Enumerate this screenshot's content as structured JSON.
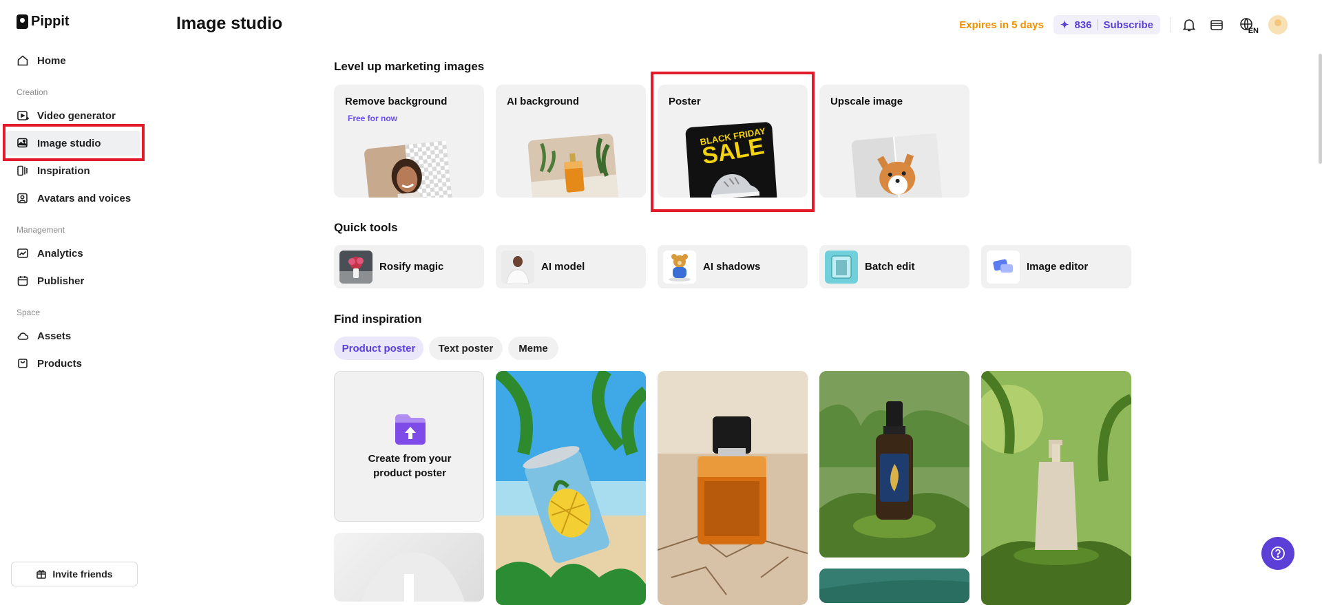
{
  "app": {
    "name": "Pippit"
  },
  "sidebar": {
    "home": "Home",
    "sections": {
      "creation": "Creation",
      "management": "Management",
      "space": "Space"
    },
    "items": [
      {
        "label": "Video generator"
      },
      {
        "label": "Image studio"
      },
      {
        "label": "Inspiration"
      },
      {
        "label": "Avatars and voices"
      },
      {
        "label": "Analytics"
      },
      {
        "label": "Publisher"
      },
      {
        "label": "Assets"
      },
      {
        "label": "Products"
      }
    ],
    "invite": "Invite friends"
  },
  "header": {
    "title": "Image studio",
    "expires": "Expires in 5 days",
    "credits": "836",
    "subscribe": "Subscribe",
    "language": "EN"
  },
  "marketing": {
    "title": "Level up marketing images",
    "cards": [
      {
        "label": "Remove background",
        "badge": "Free for now"
      },
      {
        "label": "AI background"
      },
      {
        "label": "Poster",
        "poster_text_1": "BLACK FRIDAY",
        "poster_text_2": "SALE"
      },
      {
        "label": "Upscale image"
      }
    ]
  },
  "quick_tools": {
    "title": "Quick tools",
    "items": [
      {
        "label": "Rosify magic"
      },
      {
        "label": "AI model"
      },
      {
        "label": "AI shadows"
      },
      {
        "label": "Batch edit"
      },
      {
        "label": "Image editor"
      }
    ]
  },
  "inspiration": {
    "title": "Find inspiration",
    "chips": [
      "Product poster",
      "Text poster",
      "Meme"
    ],
    "create_card": "Create from your product poster"
  },
  "colors": {
    "accent": "#5b3fd6",
    "highlight": "#e31a2a",
    "expires": "#f29000"
  }
}
